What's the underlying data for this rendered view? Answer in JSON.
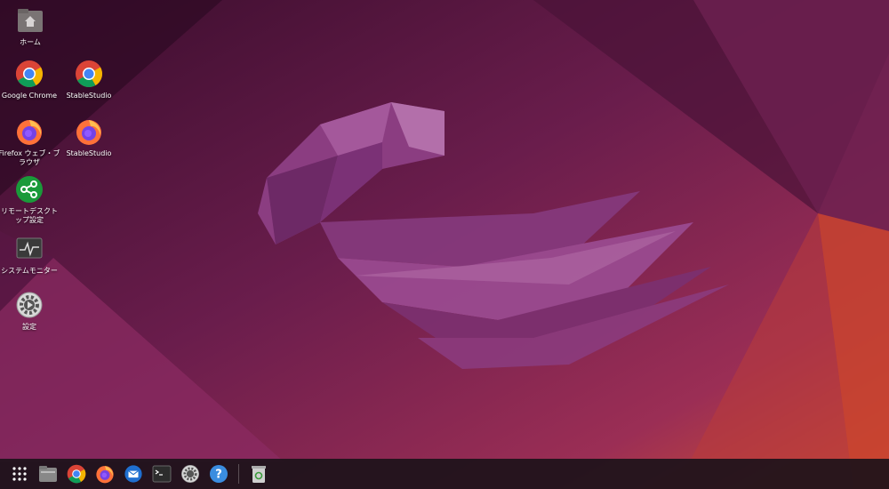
{
  "desktop": {
    "icons": [
      {
        "id": "home",
        "label": "ホーム",
        "icon": "home-folder-icon"
      },
      {
        "id": "chrome",
        "label": "Google Chrome",
        "icon": "chrome-icon"
      },
      {
        "id": "stablestudio1",
        "label": "StableStudio",
        "icon": "chrome-icon"
      },
      {
        "id": "firefox",
        "label": "Firefox ウェブ・ブラウザ",
        "icon": "firefox-icon"
      },
      {
        "id": "stablestudio2",
        "label": "StableStudio",
        "icon": "firefox-icon"
      },
      {
        "id": "remote",
        "label": "リモートデスクトップ設定",
        "icon": "share-icon"
      },
      {
        "id": "sysmon",
        "label": "システムモニター",
        "icon": "system-monitor-icon"
      },
      {
        "id": "settings",
        "label": "設定",
        "icon": "settings-gear-icon"
      }
    ]
  },
  "dock": {
    "items": [
      "app-grid-icon",
      "files-icon",
      "chrome-icon",
      "firefox-icon",
      "thunderbird-icon",
      "terminal-icon",
      "settings-gear-icon",
      "help-icon",
      "trash-icon"
    ]
  },
  "colors": {
    "wallpaper_dark": "#3a0f2e",
    "wallpaper_mid": "#7a2355",
    "wallpaper_orange": "#d24a32",
    "jellyfish": "#9a4f94"
  }
}
